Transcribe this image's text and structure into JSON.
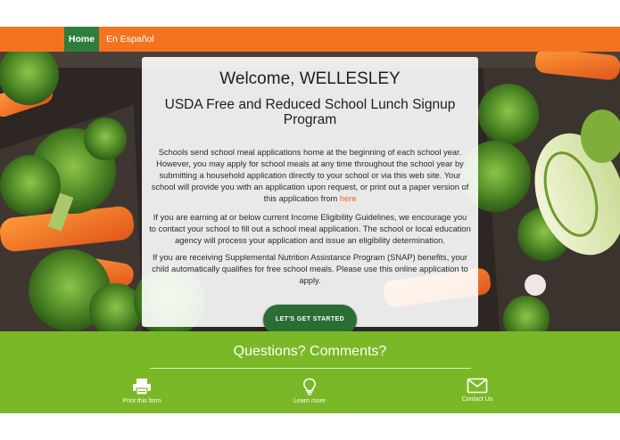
{
  "nav": {
    "home_label": "Home",
    "spanish_label": "En Español"
  },
  "card": {
    "title": "Welcome, WELLESLEY",
    "subtitle": "USDA Free and Reduced School Lunch Signup Program",
    "p1_text": "Schools send school meal applications home at the beginning of each school year. However, you may apply for school meals at any time throughout the school year by submitting a household application directly to your school or via this web site. Your school will provide you with an application upon request, or print out a paper version of this application from ",
    "p1_link": "here",
    "p2_text": "If you are earning at or below current Income Eligibility Guidelines, we encourage you to contact your school to fill out a school meal application. The school or local education agency will process your application and issue an eligibility determination.",
    "p3_text": "If you are receiving Supplemental Nutrition Assistance Program (SNAP) benefits, your child automatically qualifies for free school meals. Please use this online application to apply."
  },
  "cta": {
    "label": "LET'S GET STARTED"
  },
  "footer": {
    "title": "Questions? Comments?",
    "items": [
      {
        "label": "Print this form",
        "icon": "printer-icon"
      },
      {
        "label": "Learn more",
        "icon": "lightbulb-icon"
      },
      {
        "label": "Contact Us",
        "icon": "envelope-icon"
      }
    ]
  },
  "colors": {
    "nav_orange": "#f3731f",
    "nav_active_green": "#2f7d3c",
    "footer_green": "#7ab827",
    "cta_green": "#2a6e33",
    "link_orange": "#e3691c"
  }
}
